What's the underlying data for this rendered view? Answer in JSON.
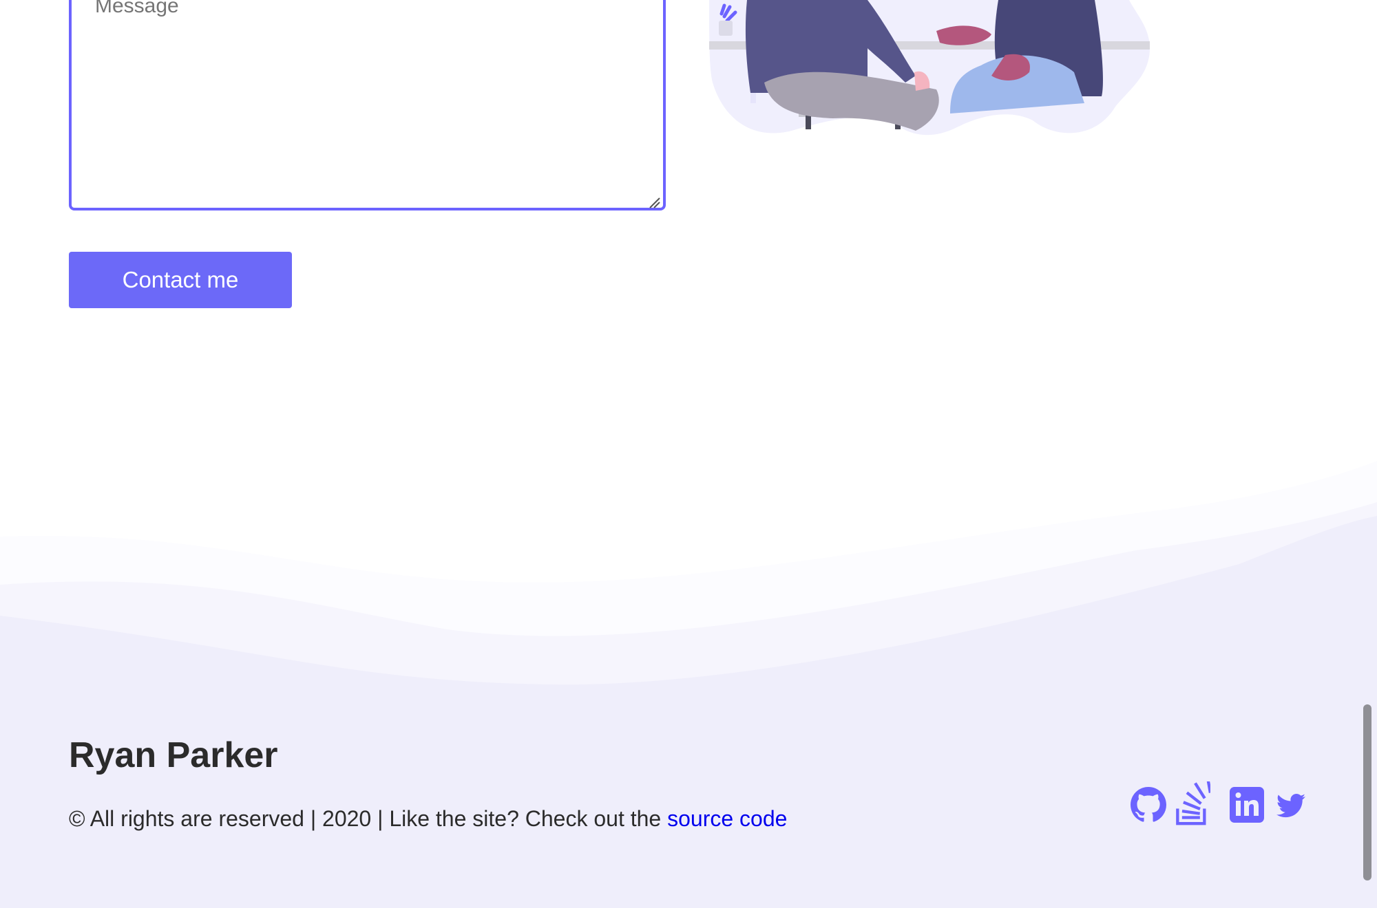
{
  "form": {
    "message_placeholder": "Message",
    "submit_label": "Contact me"
  },
  "footer": {
    "name": "Ryan Parker",
    "copyright_text": "© All rights are reserved | 2020 | Like the site? Check out the ",
    "source_link_label": "source code",
    "social_icons": [
      "github-icon",
      "stackoverflow-icon",
      "linkedin-icon",
      "twitter-icon"
    ]
  },
  "colors": {
    "accent": "#6c63ff",
    "button": "#6c69f8",
    "footer_background": "#efeefb",
    "link": "#0000ee",
    "text": "#2b2b2b"
  }
}
